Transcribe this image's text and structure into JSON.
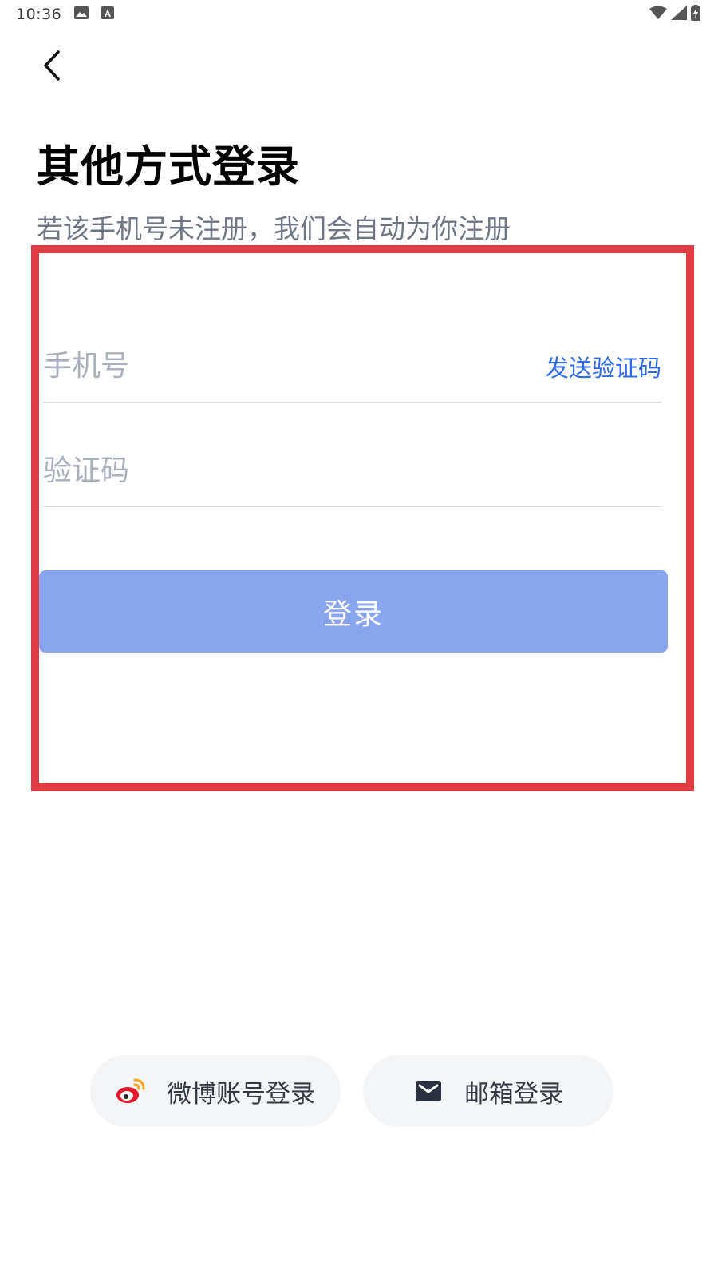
{
  "status_bar": {
    "time": "10:36",
    "icons": [
      "image-icon",
      "text-a-icon",
      "wifi-icon",
      "cell-signal-icon",
      "battery-charging-icon"
    ]
  },
  "header": {
    "back_icon": "chevron-left-icon",
    "title": "其他方式登录",
    "subtitle": "若该手机号未注册，我们会自动为你注册"
  },
  "form": {
    "phone_placeholder": "手机号",
    "phone_value": "",
    "send_code_label": "发送验证码",
    "code_placeholder": "验证码",
    "code_value": "",
    "login_label": "登录"
  },
  "alt_login": {
    "weibo_label": "微博账号登录",
    "weibo_icon": "weibo-icon",
    "email_label": "邮箱登录",
    "email_icon": "mail-icon"
  },
  "colors": {
    "highlight_border": "#e03c41",
    "login_button": "#89a5f0",
    "link": "#2e6be6",
    "placeholder": "#a9b0bc",
    "subtitle": "#6e7684",
    "alt_button_bg": "#f4f5f7"
  }
}
